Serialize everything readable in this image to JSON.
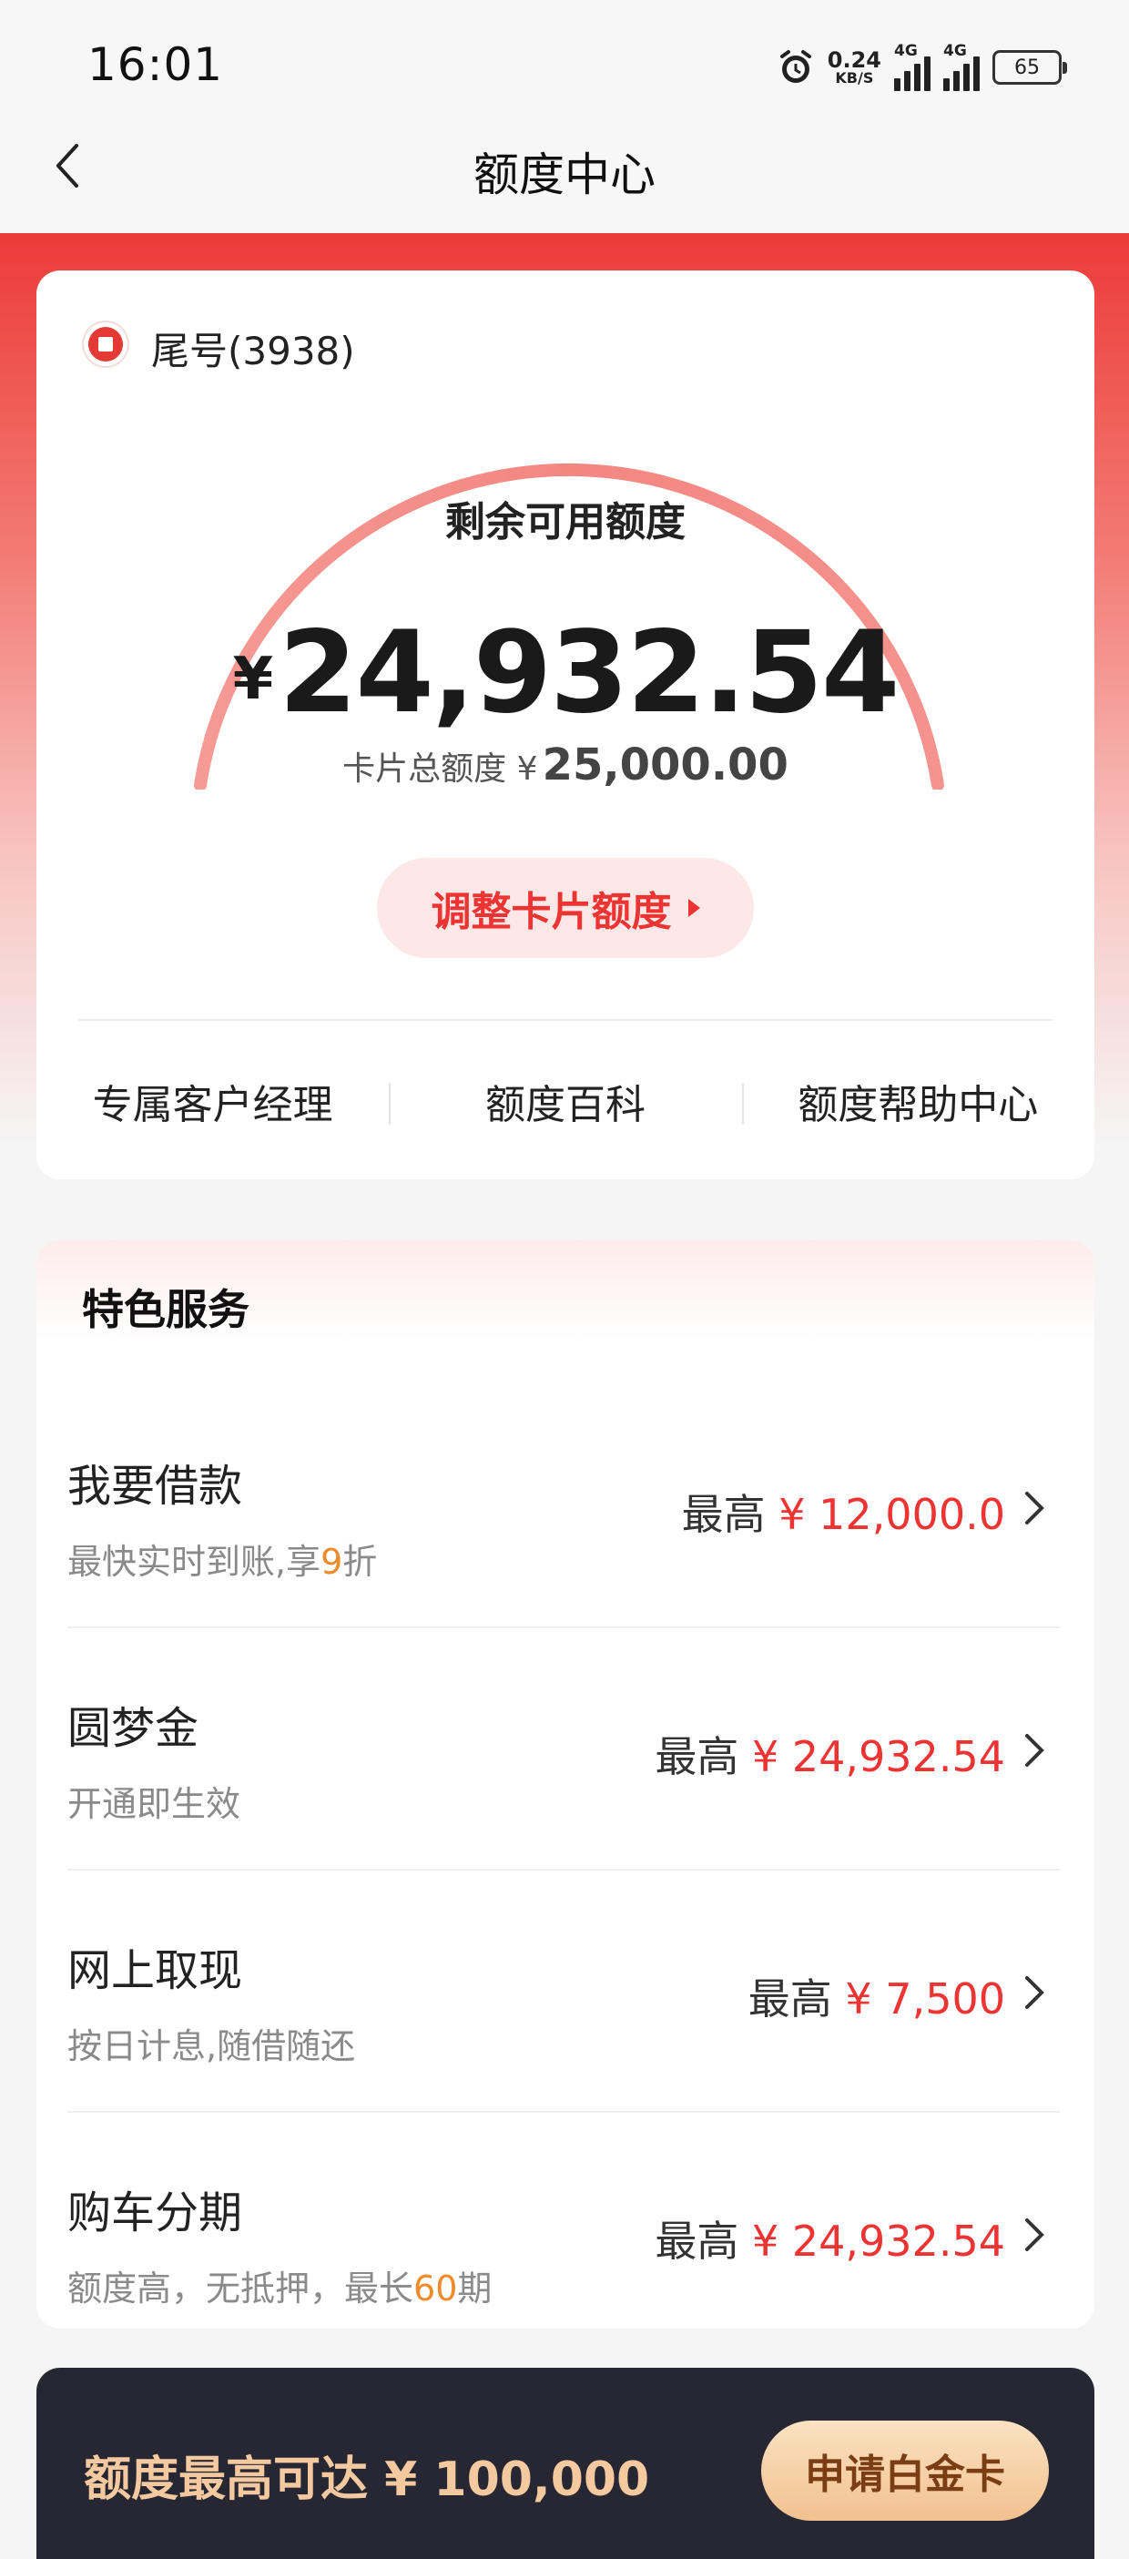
{
  "status_bar": {
    "time": "16:01",
    "net_speed_value": "0.24",
    "net_speed_unit": "KB/S",
    "signal1_tag": "4G",
    "signal2_tag": "4G",
    "battery": "65"
  },
  "header": {
    "title": "额度中心"
  },
  "card": {
    "card_number": "尾号(3938)",
    "gauge_label": "剩余可用额度",
    "currency_symbol": "¥",
    "available_amount": "24,932.54",
    "total_label": "卡片总额度 ¥",
    "total_amount": "25,000.00",
    "adjust_button": "调整卡片额度",
    "links": [
      "专属客户经理",
      "额度百科",
      "额度帮助中心"
    ]
  },
  "services": {
    "title": "特色服务",
    "items": [
      {
        "name": "我要借款",
        "desc_prefix": "最快实时到账,享",
        "desc_highlight": "9",
        "desc_suffix": "折",
        "max_label": "最高",
        "amount": "¥ 12,000.0"
      },
      {
        "name": "圆梦金",
        "desc_prefix": "开通即生效",
        "desc_highlight": "",
        "desc_suffix": "",
        "max_label": "最高",
        "amount": "¥ 24,932.54"
      },
      {
        "name": "网上取现",
        "desc_prefix": "按日计息,随借随还",
        "desc_highlight": "",
        "desc_suffix": "",
        "max_label": "最高",
        "amount": "¥ 7,500"
      },
      {
        "name": "购车分期",
        "desc_prefix": "额度高，无抵押，最长",
        "desc_highlight": "60",
        "desc_suffix": "期",
        "max_label": "最高",
        "amount": "¥ 24,932.54"
      }
    ]
  },
  "banner": {
    "text": "额度最高可达 ¥ 100,000",
    "button": "申请白金卡"
  },
  "colors": {
    "accent_red": "#e33333",
    "highlight_orange": "#f08a2a",
    "banner_bg": "#262733",
    "banner_gold": "#f4c9a0"
  }
}
